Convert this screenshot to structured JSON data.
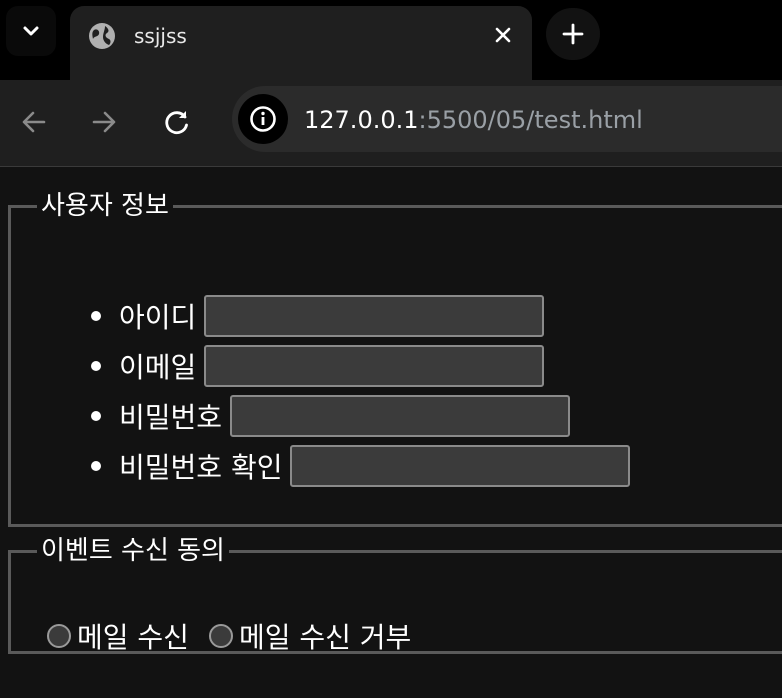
{
  "browser": {
    "tab_title": "ssjjss",
    "url_host": "127.0.0.1",
    "url_rest": ":5500/05/test.html",
    "icons": {
      "tab_menu": "chevron-down-icon",
      "tab_favicon": "globe-icon",
      "tab_close": "close-icon",
      "new_tab": "plus-icon",
      "back": "arrow-left-icon",
      "forward": "arrow-right-icon",
      "reload": "reload-icon",
      "site_info": "info-icon"
    }
  },
  "user_info": {
    "legend": "사용자 정보",
    "fields": [
      {
        "label": "아이디",
        "value": ""
      },
      {
        "label": "이메일",
        "value": ""
      },
      {
        "label": "비밀번호",
        "value": ""
      },
      {
        "label": "비밀번호 확인",
        "value": ""
      }
    ]
  },
  "event": {
    "legend": "이벤트 수신 동의",
    "options": [
      {
        "label": "메일 수신",
        "checked": false
      },
      {
        "label": "메일 수신 거부",
        "checked": false
      }
    ]
  },
  "colors": {
    "page_bg": "#121212",
    "tab_bg": "#1f1f1f",
    "input_bg": "#3b3b3b",
    "border": "#5a5a5a"
  }
}
